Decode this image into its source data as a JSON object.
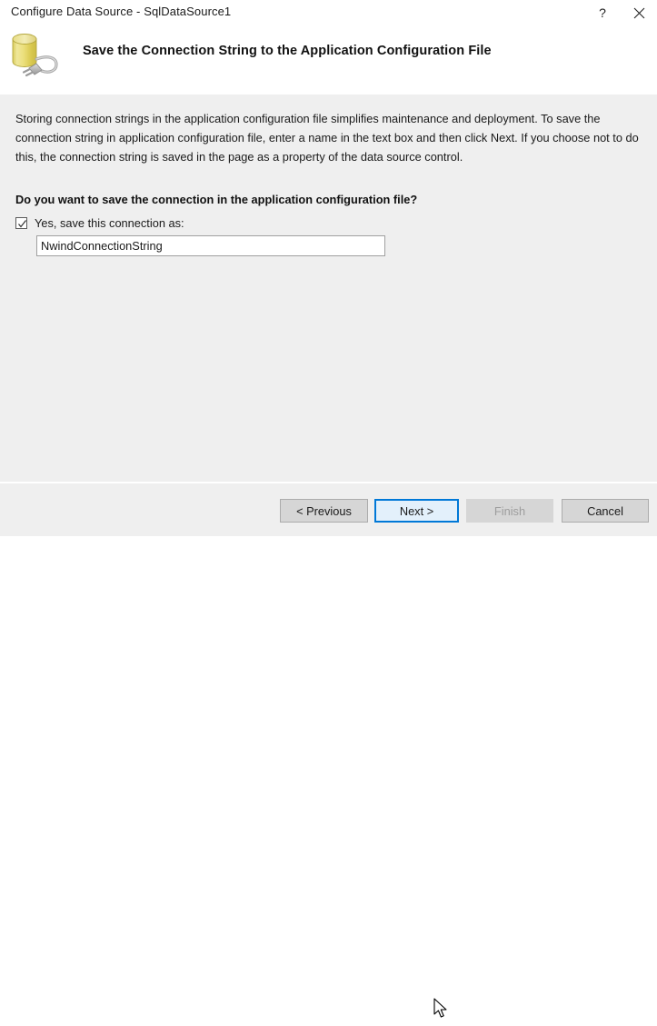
{
  "window": {
    "title": "Configure Data Source - SqlDataSource1",
    "help_label": "?",
    "close_label": "×"
  },
  "header": {
    "icon": "database-connection-icon",
    "title": "Save the Connection String to the Application Configuration File"
  },
  "content": {
    "description": "Storing connection strings in the application configuration file simplifies maintenance and deployment. To save the connection string in application configuration file, enter a name in the text box and then click Next. If you choose not to do this, the connection string is saved in the page as a property of the data source control.",
    "question": "Do you want to save the connection in the application configuration file?",
    "save_checkbox": {
      "label": "Yes, save this connection as:",
      "checked": true
    },
    "connection_name_input": {
      "value": "NwindConnectionString",
      "placeholder": ""
    }
  },
  "footer": {
    "buttons": [
      {
        "label": "< Previous",
        "state": "enabled"
      },
      {
        "label": "Next >",
        "state": "hovered"
      },
      {
        "label": "Finish",
        "state": "disabled"
      },
      {
        "label": "Cancel",
        "state": "enabled"
      }
    ]
  },
  "colors": {
    "content_background": "#efefef",
    "header_background": "#ffffff",
    "accent_focus_border": "#0078d7",
    "hover_button_fill": "#e3f0fb",
    "button_face": "#d6d6d6",
    "disabled_text": "#9d9d9d",
    "icon_cylinder": "#e8dd7a",
    "icon_plug": "#b8b8b8"
  }
}
